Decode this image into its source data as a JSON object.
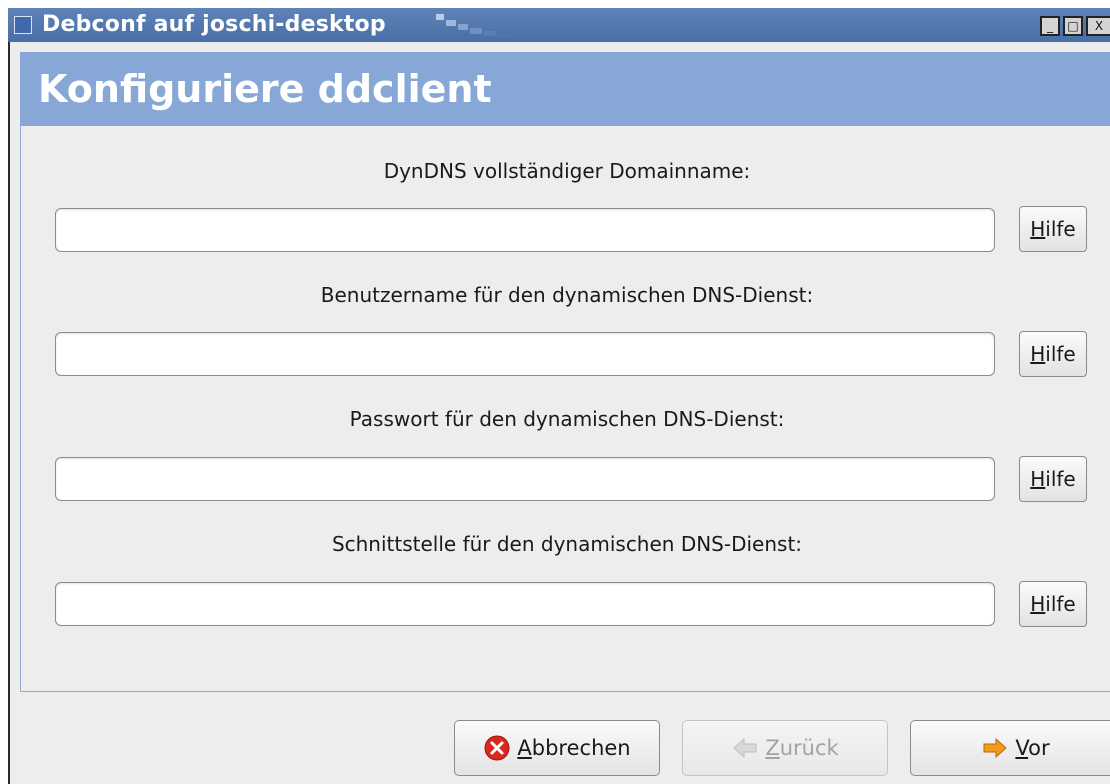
{
  "window": {
    "title": "Debconf auf joschi-desktop",
    "controls": {
      "minimize": "_",
      "maximize": "□",
      "close": "X"
    }
  },
  "header": {
    "title": "Konfiguriere ddclient"
  },
  "fields": [
    {
      "label": "DynDNS vollständiger Domainname:",
      "value": "",
      "help_prefix": "H",
      "help_rest": "ilfe"
    },
    {
      "label": "Benutzername für den dynamischen DNS-Dienst:",
      "value": "",
      "help_prefix": "H",
      "help_rest": "ilfe"
    },
    {
      "label": "Passwort für den dynamischen DNS-Dienst:",
      "value": "",
      "help_prefix": "H",
      "help_rest": "ilfe"
    },
    {
      "label": "Schnittstelle für den dynamischen DNS-Dienst:",
      "value": "",
      "help_prefix": "H",
      "help_rest": "ilfe"
    }
  ],
  "buttons": {
    "cancel": {
      "mnemonic": "A",
      "rest": "bbrechen",
      "icon": "cancel-icon"
    },
    "back": {
      "mnemonic": "Z",
      "rest": "urück",
      "icon": "back-arrow-icon",
      "enabled": false
    },
    "next": {
      "mnemonic": "V",
      "rest": "or",
      "icon": "forward-arrow-icon"
    }
  },
  "colors": {
    "titlebar": "#486fa6",
    "header": "#87a8d6",
    "window_bg": "#ededed",
    "cancel_red": "#d72a1e",
    "arrow_orange": "#f39a1e"
  }
}
